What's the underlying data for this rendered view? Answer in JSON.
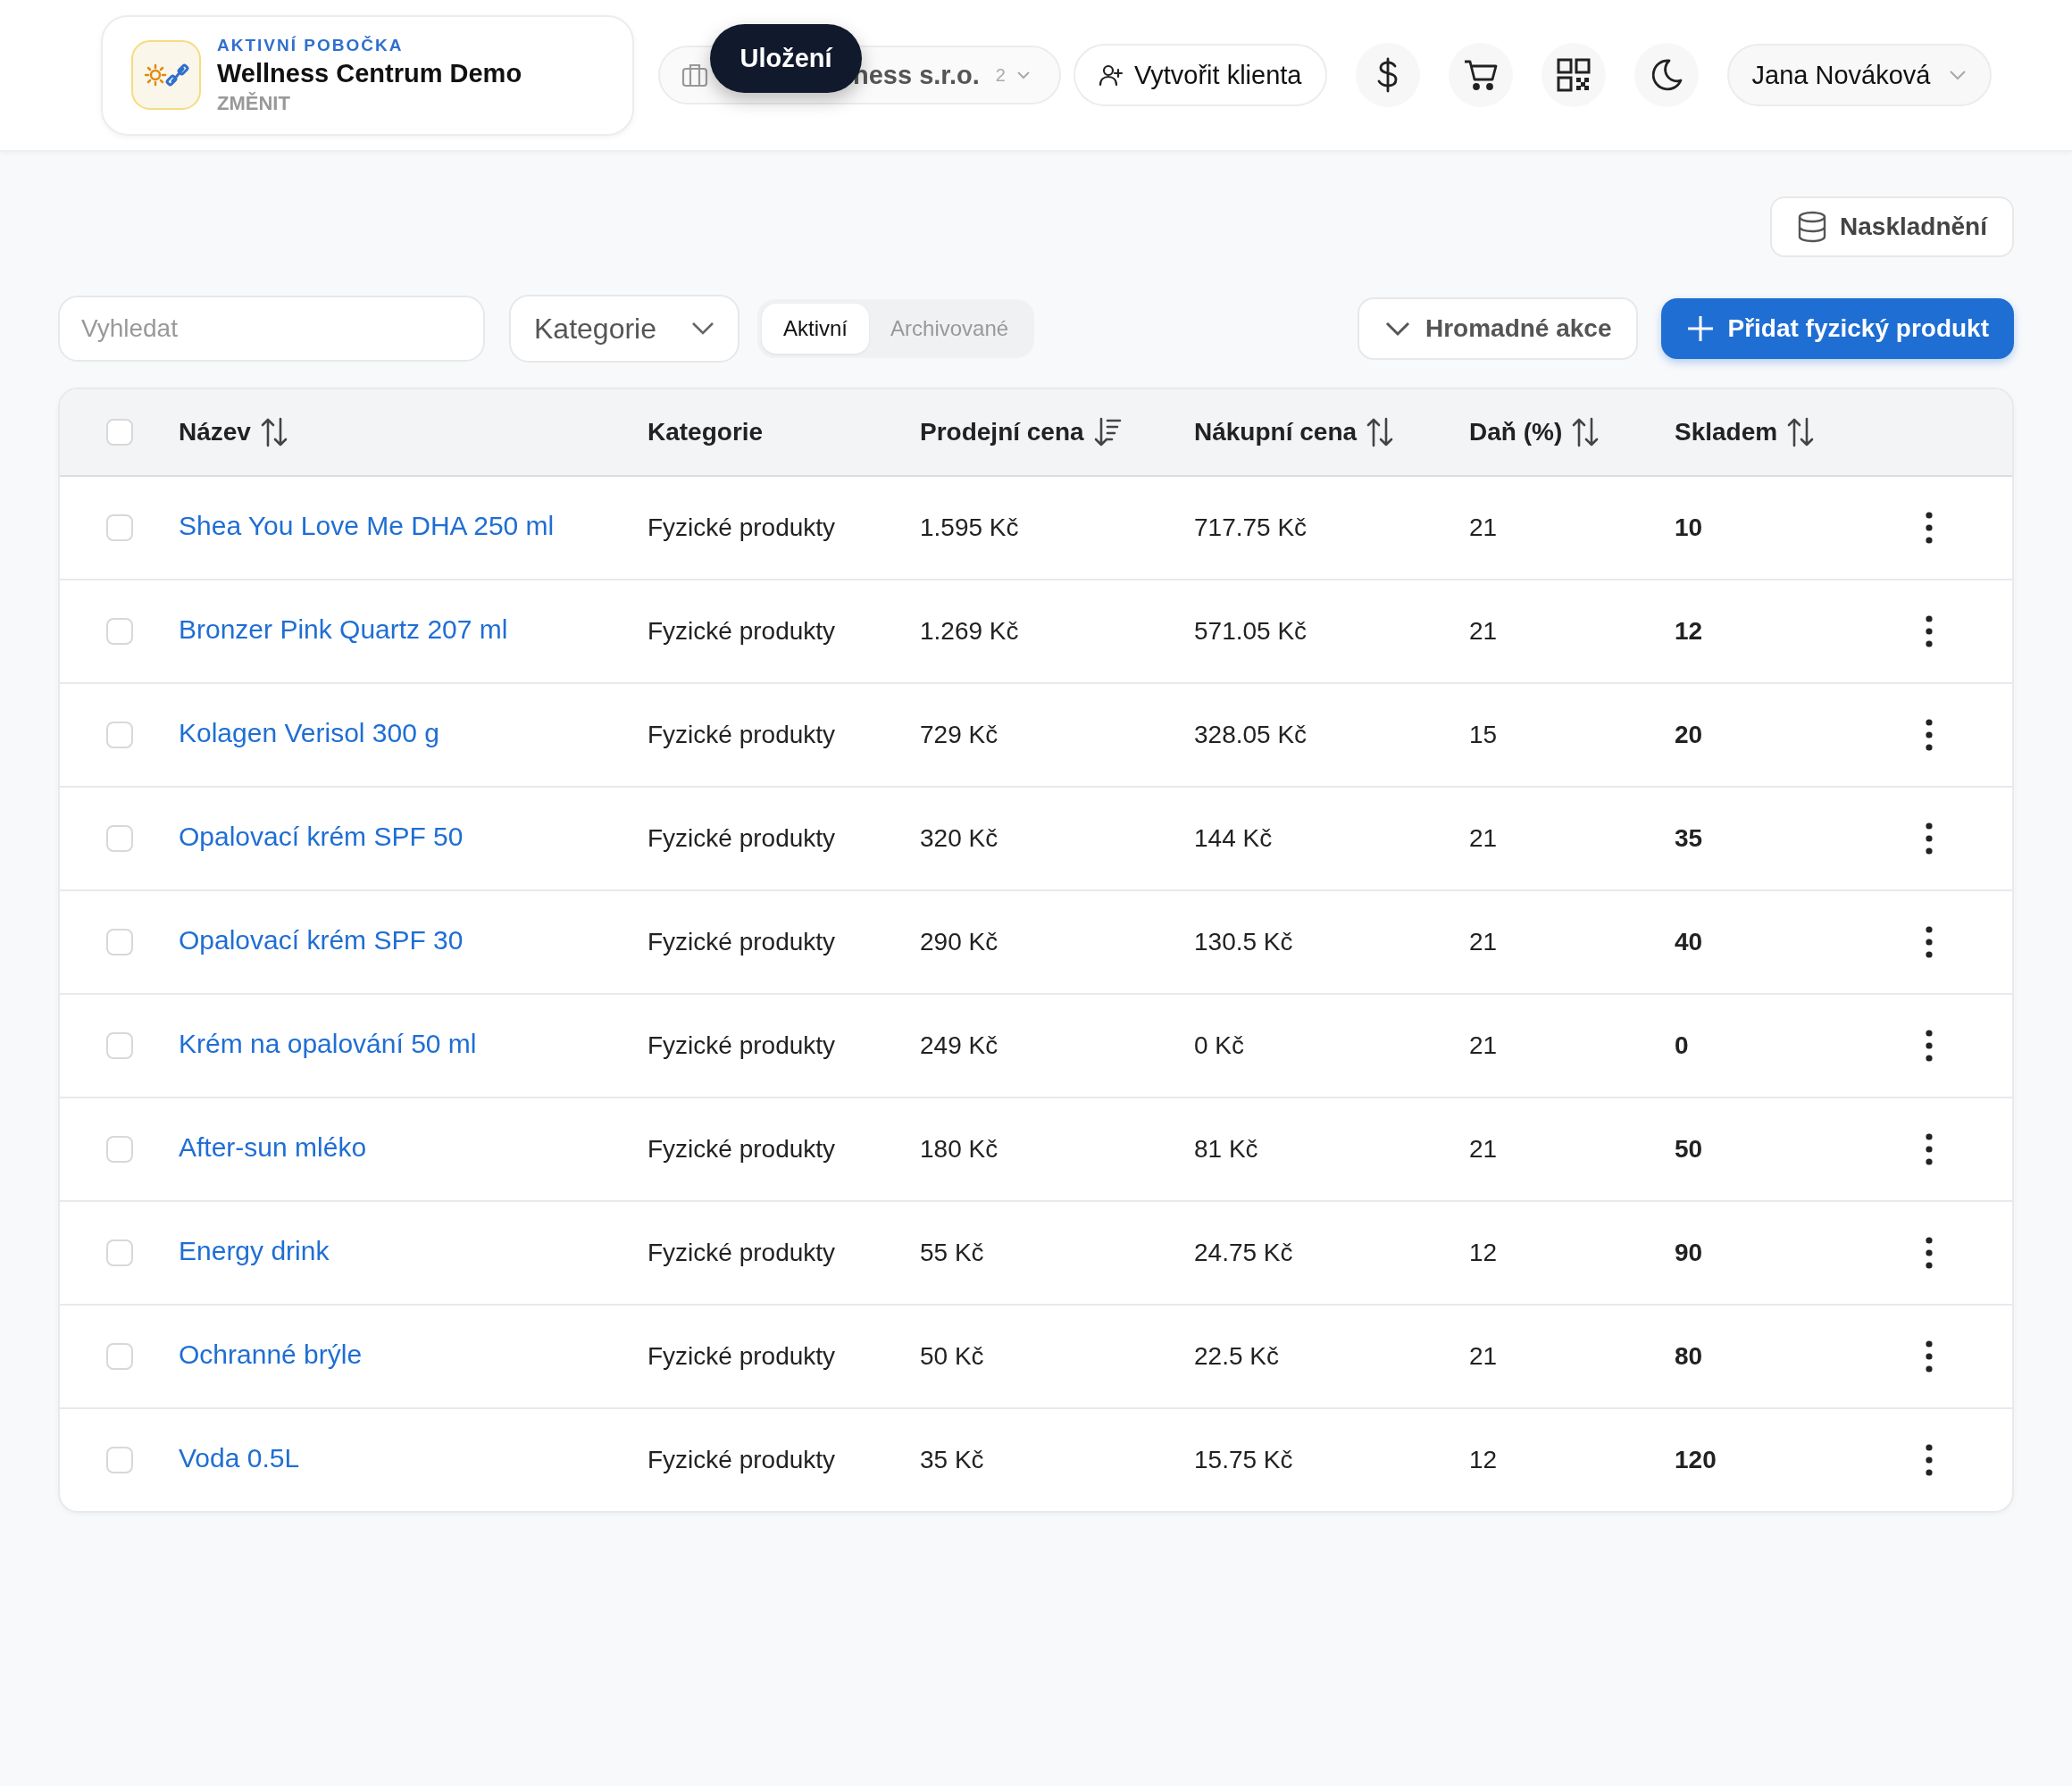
{
  "header": {
    "branch": {
      "label": "AKTIVNÍ POBOČKA",
      "name": "Wellness Centrum Demo",
      "action": "ZMĚNIT"
    },
    "company_selector": {
      "text": "ness s.r.o.",
      "count": "2"
    },
    "tooltip": "Uložení",
    "create_client_button": "Vytvořit klienta",
    "icon_buttons": [
      {
        "kind": "dollar"
      },
      {
        "kind": "cart"
      },
      {
        "kind": "qr"
      },
      {
        "kind": "moon"
      }
    ],
    "user": "Jana Nováková"
  },
  "stock_button": "Naskladnění",
  "toolbar": {
    "search": {
      "placeholder": "Vyhledat"
    },
    "category_filter": "Kategorie",
    "status_tabs": [
      {
        "label": "Aktivní",
        "selected": true
      },
      {
        "label": "Archivované",
        "selected": false
      }
    ],
    "bulk_actions": "Hromadné akce",
    "add_button": "Přidat fyzický produkt"
  },
  "table": {
    "select_all_checked": false,
    "columns": [
      {
        "label": "Název",
        "sortable": true,
        "sorted": false
      },
      {
        "label": "Kategorie",
        "sortable": false,
        "sorted": false
      },
      {
        "label": "Prodejní cena",
        "sortable": true,
        "sorted": true
      },
      {
        "label": "Nákupní cena",
        "sortable": true,
        "sorted": false
      },
      {
        "label": "Daň (%)",
        "sortable": true,
        "sorted": false
      },
      {
        "label": "Skladem",
        "sortable": true,
        "sorted": false
      }
    ],
    "rows": [
      {
        "checked": false,
        "name": "Shea You Love Me DHA 250 ml",
        "category": "Fyzické produkty",
        "price": "1.595 Kč",
        "cost": "717.75 Kč",
        "tax": "21",
        "stock": "10"
      },
      {
        "checked": false,
        "name": "Bronzer Pink Quartz 207 ml",
        "category": "Fyzické produkty",
        "price": "1.269 Kč",
        "cost": "571.05 Kč",
        "tax": "21",
        "stock": "12"
      },
      {
        "checked": false,
        "name": "Kolagen Verisol 300 g",
        "category": "Fyzické produkty",
        "price": "729 Kč",
        "cost": "328.05 Kč",
        "tax": "15",
        "stock": "20"
      },
      {
        "checked": false,
        "name": "Opalovací krém SPF 50",
        "category": "Fyzické produkty",
        "price": "320 Kč",
        "cost": "144 Kč",
        "tax": "21",
        "stock": "35"
      },
      {
        "checked": false,
        "name": "Opalovací krém SPF 30",
        "category": "Fyzické produkty",
        "price": "290 Kč",
        "cost": "130.5 Kč",
        "tax": "21",
        "stock": "40"
      },
      {
        "checked": false,
        "name": "Krém na opalování 50 ml",
        "category": "Fyzické produkty",
        "price": "249 Kč",
        "cost": "0 Kč",
        "tax": "21",
        "stock": "0"
      },
      {
        "checked": false,
        "name": "After-sun mléko",
        "category": "Fyzické produkty",
        "price": "180 Kč",
        "cost": "81 Kč",
        "tax": "21",
        "stock": "50"
      },
      {
        "checked": false,
        "name": "Energy drink",
        "category": "Fyzické produkty",
        "price": "55 Kč",
        "cost": "24.75 Kč",
        "tax": "12",
        "stock": "90"
      },
      {
        "checked": false,
        "name": "Ochranné brýle",
        "category": "Fyzické produkty",
        "price": "50 Kč",
        "cost": "22.5 Kč",
        "tax": "21",
        "stock": "80"
      },
      {
        "checked": false,
        "name": "Voda 0.5L",
        "category": "Fyzické produkty",
        "price": "35 Kč",
        "cost": "15.75 Kč",
        "tax": "12",
        "stock": "120"
      }
    ]
  }
}
